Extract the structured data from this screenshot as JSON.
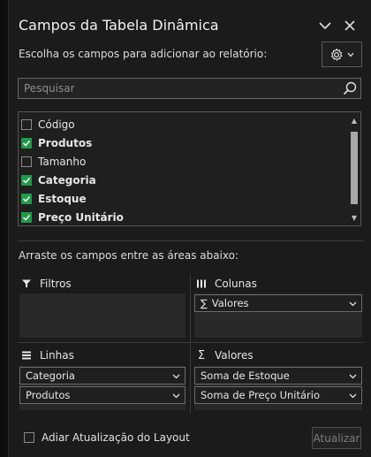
{
  "header": {
    "title": "Campos da Tabela Dinâmica"
  },
  "instruction": "Escolha os campos para adicionar ao relatório:",
  "search": {
    "placeholder": "Pesquisar",
    "value": ""
  },
  "fields": [
    {
      "label": "Código",
      "checked": false
    },
    {
      "label": "Produtos",
      "checked": true
    },
    {
      "label": "Tamanho",
      "checked": false
    },
    {
      "label": "Categoria",
      "checked": true
    },
    {
      "label": "Estoque",
      "checked": true
    },
    {
      "label": "Preço Unitário",
      "checked": true
    }
  ],
  "drag_instruction": "Arraste os campos entre as áreas abaixo:",
  "areas": {
    "filters": {
      "title": "Filtros",
      "items": []
    },
    "columns": {
      "title": "Colunas",
      "items": [
        "Valores"
      ]
    },
    "rows": {
      "title": "Linhas",
      "items": [
        "Categoria",
        "Produtos"
      ]
    },
    "values": {
      "title": "Valores",
      "items": [
        "Soma de Estoque",
        "Soma de Preço Unitário"
      ]
    }
  },
  "footer": {
    "defer_label": "Adiar Atualização do Layout",
    "update_label": "Atualizar"
  },
  "colors": {
    "check_green": "#1f9a48",
    "background": "#1b1b1b"
  },
  "icons": [
    "chevron-down-icon",
    "close-icon",
    "gear-icon",
    "search-icon",
    "filter-icon",
    "columns-icon",
    "rows-icon",
    "sigma-icon"
  ]
}
